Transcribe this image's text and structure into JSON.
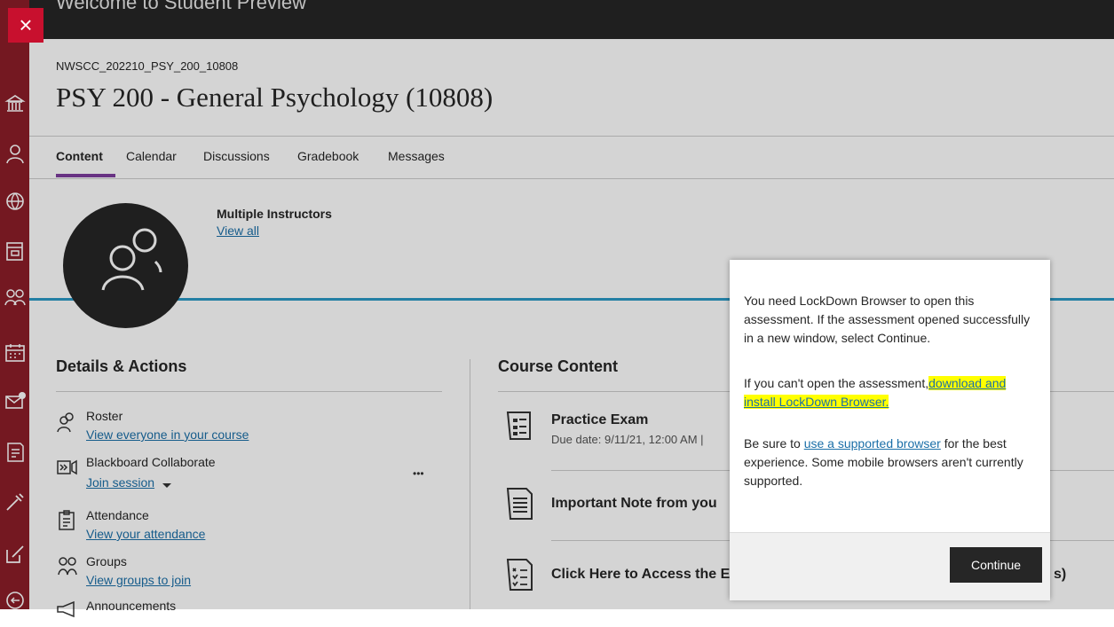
{
  "window": {
    "close_symbol": "×",
    "title": "Welcome to Student Preview"
  },
  "left_nav": {
    "icons": [
      "institution-icon",
      "person-icon",
      "globe-icon",
      "courses-icon",
      "groups-icon",
      "calendar-icon",
      "messages-icon",
      "grades-icon",
      "tools-icon",
      "edit-icon",
      "signout-icon"
    ]
  },
  "course": {
    "id": "NWSCC_202210_PSY_200_10808",
    "title": "PSY 200 - General Psychology (10808)"
  },
  "tabs": [
    {
      "label": "Content"
    },
    {
      "label": "Calendar"
    },
    {
      "label": "Discussions"
    },
    {
      "label": "Gradebook"
    },
    {
      "label": "Messages"
    }
  ],
  "instructors": {
    "label": "Multiple Instructors",
    "link": "View all"
  },
  "details": {
    "heading": "Details & Actions",
    "more": "•••",
    "items": [
      {
        "label": "Roster",
        "link": "View everyone in your course"
      },
      {
        "label": "Blackboard Collaborate",
        "link": "Join session"
      },
      {
        "label": "Attendance",
        "link": "View your attendance"
      },
      {
        "label": "Groups",
        "link": "View groups to join"
      },
      {
        "label": "Announcements"
      }
    ]
  },
  "content": {
    "heading": "Course Content",
    "items": [
      {
        "title": "Practice Exam",
        "sub": "Due date: 9/11/21, 12:00 AM |"
      },
      {
        "title": "Important Note from you"
      },
      {
        "title": "Click Here to Access the E",
        "trailing": "s)"
      }
    ]
  },
  "dialog": {
    "p1": "You need LockDown Browser to open this assessment. If the assessment opened successfully in a new window, select Continue.",
    "p2_prefix": "If you can't open the assessment,",
    "p2_link_a": "download and",
    "p2_link_b": "install LockDown Browser.",
    "p3_prefix": "Be sure to",
    "p3_link": "use a supported browser",
    "p3_suffix": "for the best experience. Some mobile browsers aren't currently supported.",
    "button": "Continue"
  },
  "colors": {
    "nav": "#8c1d28",
    "close": "#c8102e",
    "topbar": "#262626",
    "accent_tab": "#7e3e9e",
    "banner_line": "#2b99c6",
    "link": "#1b6fa8",
    "highlight": "#ffff00"
  }
}
